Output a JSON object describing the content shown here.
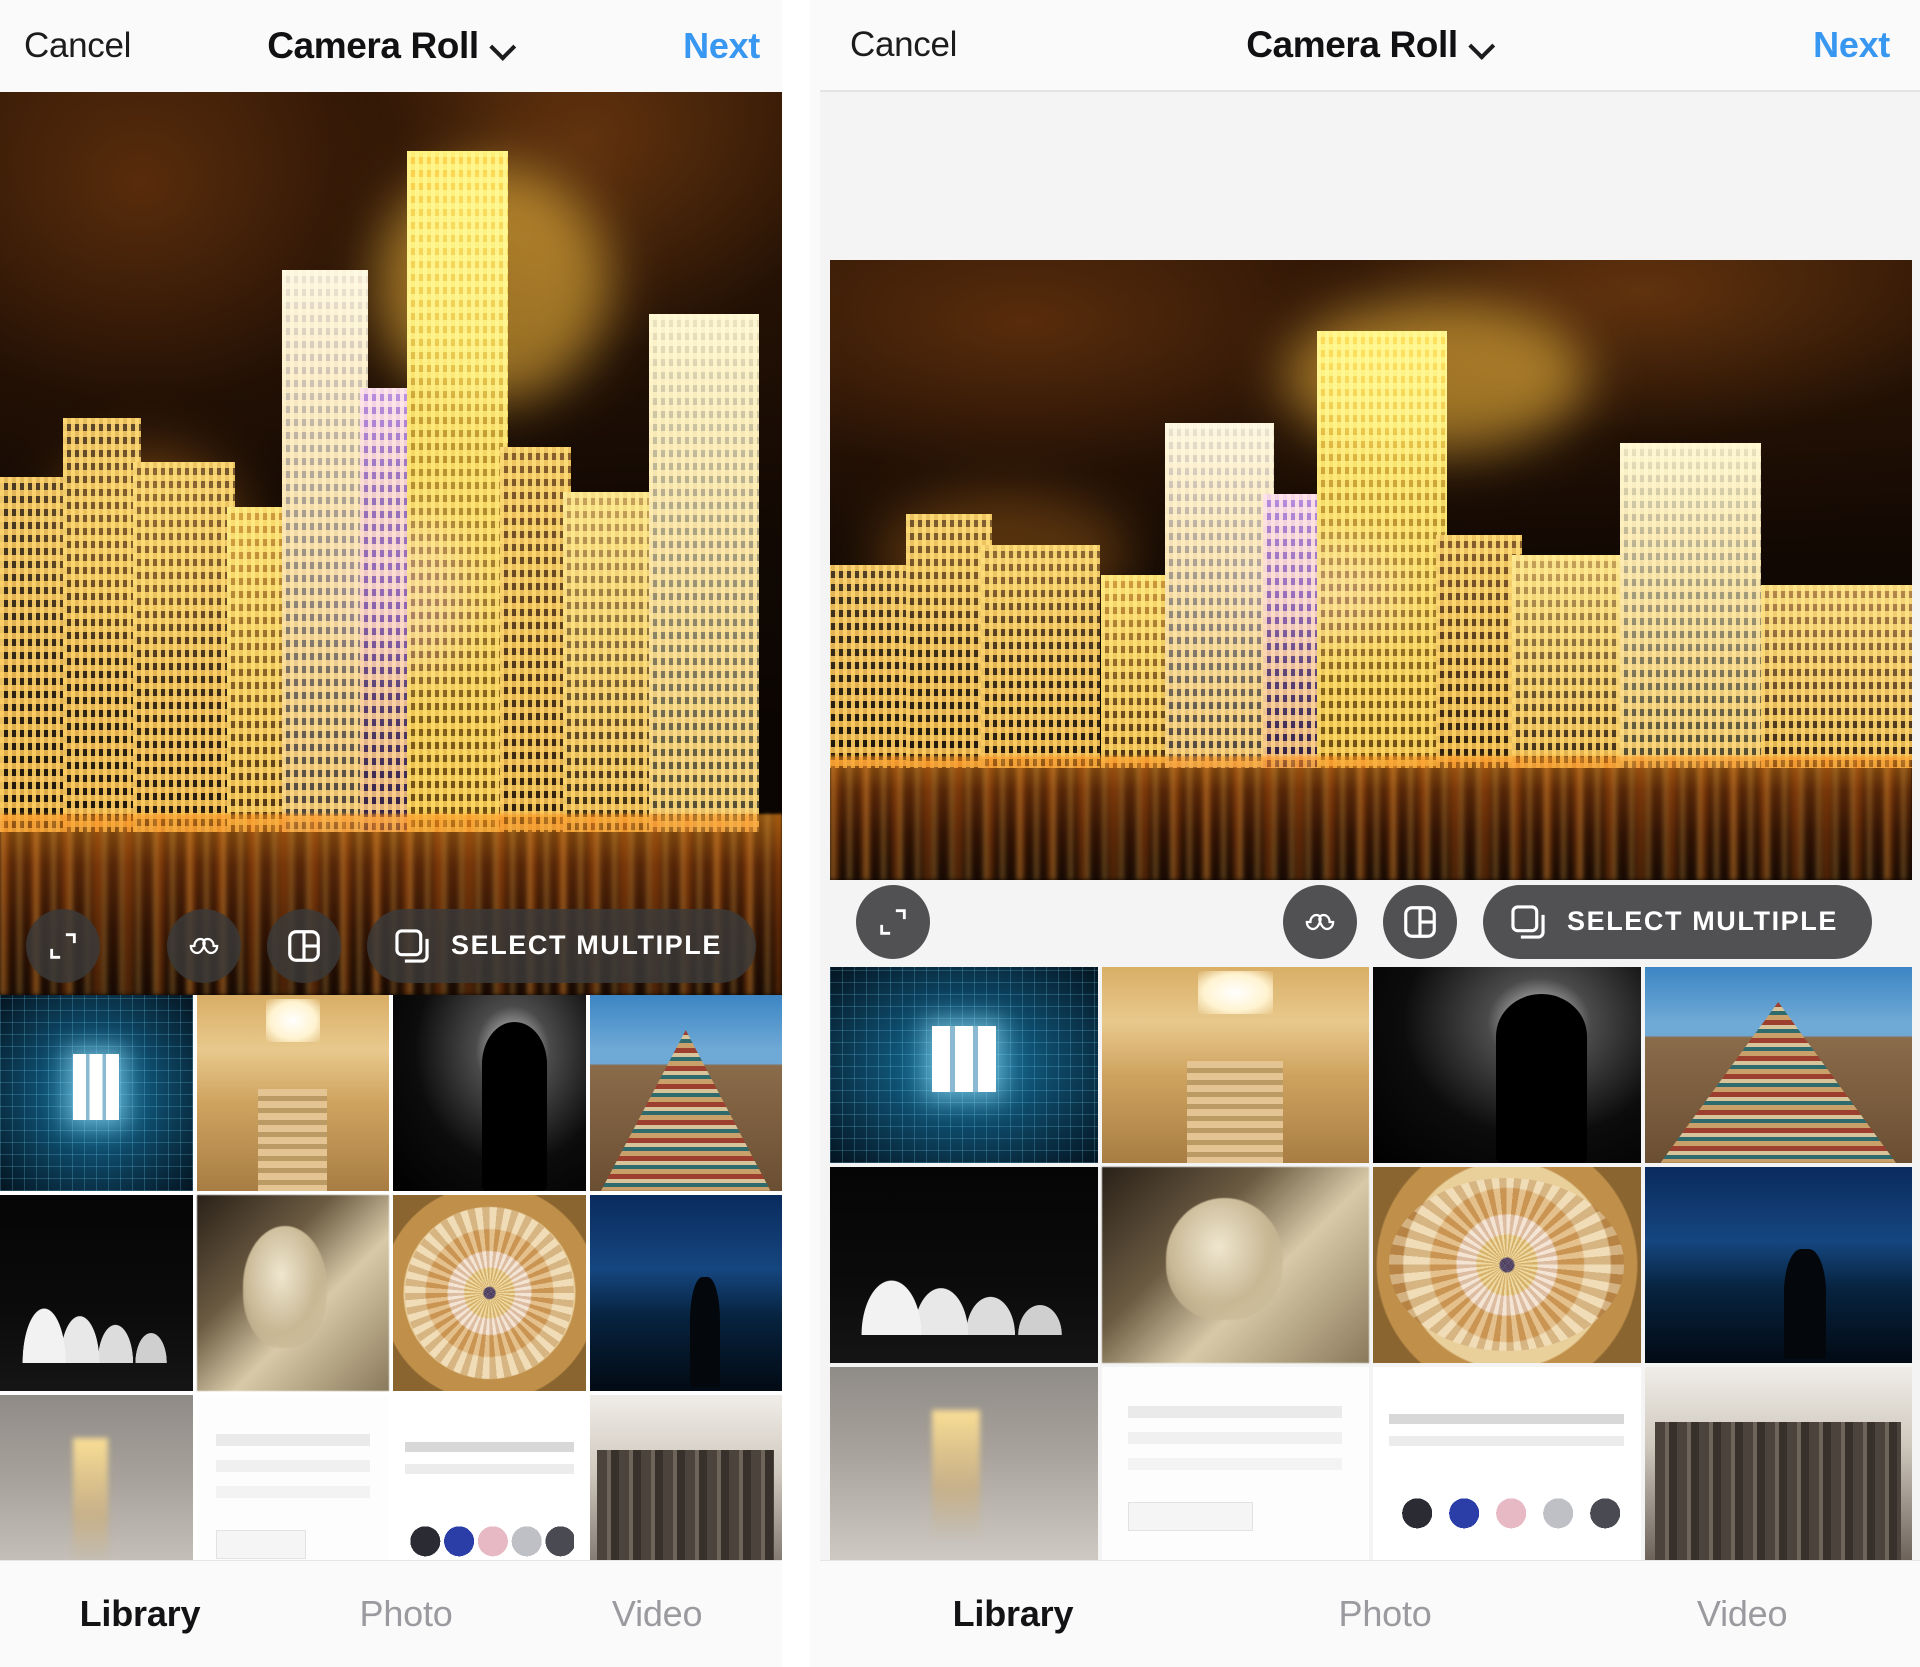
{
  "screens": [
    {
      "id": "screen-left",
      "nav": {
        "cancel_label": "Cancel",
        "title": "Camera Roll",
        "chevron_icon": "chevron-down-icon",
        "next_label": "Next",
        "next_color": "#3897f0"
      },
      "hero": {
        "alt": "Night cityscape of illuminated skyscrapers reflected in water"
      },
      "toolbar": {
        "expand_icon": "expand-crop-icon",
        "boomerang_icon": "infinity-boomerang-icon",
        "layout_icon": "layout-grid-icon",
        "select_multiple_icon": "copy-stack-icon",
        "select_multiple_label": "SELECT MULTIPLE"
      },
      "grid": {
        "thumbnails": [
          {
            "name": "thumbnail-blue-tunnel",
            "art": "t-blue"
          },
          {
            "name": "thumbnail-palace-stairs",
            "art": "t-hall"
          },
          {
            "name": "thumbnail-silhouette",
            "art": "t-sil"
          },
          {
            "name": "thumbnail-temple-spire",
            "art": "t-temple"
          },
          {
            "name": "thumbnail-opera-house",
            "art": "t-opera"
          },
          {
            "name": "thumbnail-statue",
            "art": "t-statue"
          },
          {
            "name": "thumbnail-dome-ceiling",
            "art": "t-dome"
          },
          {
            "name": "thumbnail-night-skyline",
            "art": "t-night"
          },
          {
            "name": "thumbnail-foggy-tower",
            "art": "t-fog"
          },
          {
            "name": "thumbnail-document",
            "art": "t-doc"
          },
          {
            "name": "thumbnail-instagram-ui",
            "art": "t-ig"
          },
          {
            "name": "thumbnail-building-rows",
            "art": "t-bldgs"
          }
        ]
      },
      "tabs": [
        {
          "label": "Library",
          "active": true
        },
        {
          "label": "Photo",
          "active": false
        },
        {
          "label": "Video",
          "active": false
        }
      ]
    },
    {
      "id": "screen-right",
      "nav": {
        "cancel_label": "Cancel",
        "title": "Camera Roll",
        "chevron_icon": "chevron-down-icon",
        "next_label": "Next",
        "next_color": "#3897f0"
      },
      "hero": {
        "alt": "Night cityscape of illuminated skyscrapers reflected in water"
      },
      "toolbar": {
        "expand_icon": "expand-crop-icon",
        "boomerang_icon": "infinity-boomerang-icon",
        "layout_icon": "layout-grid-icon",
        "select_multiple_icon": "copy-stack-icon",
        "select_multiple_label": "SELECT MULTIPLE"
      },
      "grid": {
        "thumbnails": [
          {
            "name": "thumbnail-blue-tunnel",
            "art": "t-blue"
          },
          {
            "name": "thumbnail-palace-stairs",
            "art": "t-hall"
          },
          {
            "name": "thumbnail-silhouette",
            "art": "t-sil"
          },
          {
            "name": "thumbnail-temple-spire",
            "art": "t-temple"
          },
          {
            "name": "thumbnail-opera-house",
            "art": "t-opera"
          },
          {
            "name": "thumbnail-statue",
            "art": "t-statue"
          },
          {
            "name": "thumbnail-dome-ceiling",
            "art": "t-dome"
          },
          {
            "name": "thumbnail-night-skyline",
            "art": "t-night"
          },
          {
            "name": "thumbnail-foggy-tower",
            "art": "t-fog"
          },
          {
            "name": "thumbnail-document",
            "art": "t-doc"
          },
          {
            "name": "thumbnail-instagram-ui",
            "art": "t-ig"
          },
          {
            "name": "thumbnail-building-rows",
            "art": "t-bldgs"
          }
        ]
      },
      "tabs": [
        {
          "label": "Library",
          "active": true
        },
        {
          "label": "Photo",
          "active": false
        },
        {
          "label": "Video",
          "active": false
        }
      ]
    }
  ]
}
